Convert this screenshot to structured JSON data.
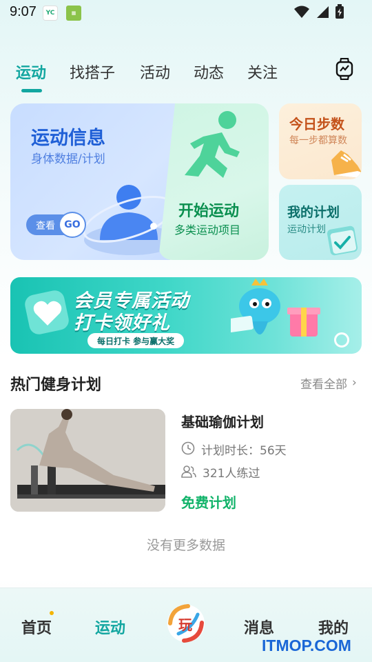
{
  "status": {
    "time": "9:07"
  },
  "tabs": [
    {
      "label": "运动",
      "active": true
    },
    {
      "label": "找搭子",
      "active": false
    },
    {
      "label": "活动",
      "active": false
    },
    {
      "label": "动态",
      "active": false
    },
    {
      "label": "关注",
      "active": false
    }
  ],
  "cards": {
    "info": {
      "title": "运动信息",
      "subtitle": "身体数据/计划",
      "see_label": "查看",
      "go_label": "GO"
    },
    "start": {
      "title": "开始运动",
      "subtitle": "多类运动项目"
    },
    "steps": {
      "title": "今日步数",
      "subtitle": "每一步都算数"
    },
    "plan": {
      "title": "我的计划",
      "subtitle": "运动计划"
    }
  },
  "banner": {
    "line1": "会员专属活动",
    "line2": "打卡领好礼",
    "tag": "每日打卡 参与赢大奖"
  },
  "section": {
    "title": "热门健身计划",
    "see_all": "查看全部"
  },
  "plan_item": {
    "name": "基础瑜伽计划",
    "duration": "计划时长：56天",
    "count": "321人练过",
    "price": "免费计划"
  },
  "footer_text": "没有更多数据",
  "nav": {
    "home": "首页",
    "sport": "运动",
    "messages": "消息",
    "mine": "我的"
  },
  "watermark": "ITMOP.COM",
  "colors": {
    "accent": "#12a6a0",
    "green": "#12b36a",
    "blue": "#1f5fd6",
    "orange": "#c4521a"
  }
}
